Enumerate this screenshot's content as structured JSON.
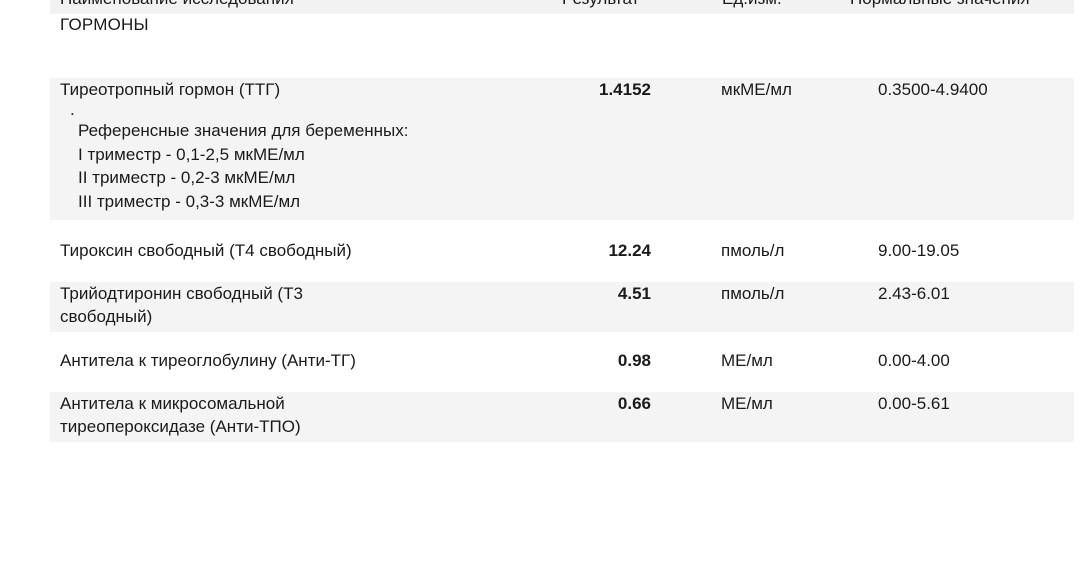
{
  "table_header": {
    "name": "Наименование исследования",
    "result": "Результат",
    "unit": "Ед.изм.",
    "norm": "Нормальные значения"
  },
  "section": {
    "title": "ГОРМОНЫ"
  },
  "rows": [
    {
      "name": "Тиреотропный гормон (ТТГ)",
      "result": "1.4152",
      "unit": "мкМЕ/мл",
      "norm": "0.3500-4.9400",
      "notes": [
        ".",
        "Референсные значения для беременных:",
        "I триместр - 0,1-2,5 мкМЕ/мл",
        "II триместр - 0,2-3 мкМЕ/мл",
        "III триместр - 0,3-3 мкМЕ/мл"
      ]
    },
    {
      "name": "Тироксин свободный (Т4 свободный)",
      "result": "12.24",
      "unit": "пмоль/л",
      "norm": "9.00-19.05"
    },
    {
      "name": "Трийодтиронин свободный (Т3 свободный)",
      "result": "4.51",
      "unit": "пмоль/л",
      "norm": "2.43-6.01"
    },
    {
      "name": "Антитела к тиреоглобулину (Анти-ТГ)",
      "result": "0.98",
      "unit": "МЕ/мл",
      "norm": "0.00-4.00"
    },
    {
      "name": "Антитела к микросомальной тиреопероксидазе (Анти-ТПО)",
      "result": "0.66",
      "unit": "МЕ/мл",
      "norm": "0.00-5.61"
    }
  ]
}
